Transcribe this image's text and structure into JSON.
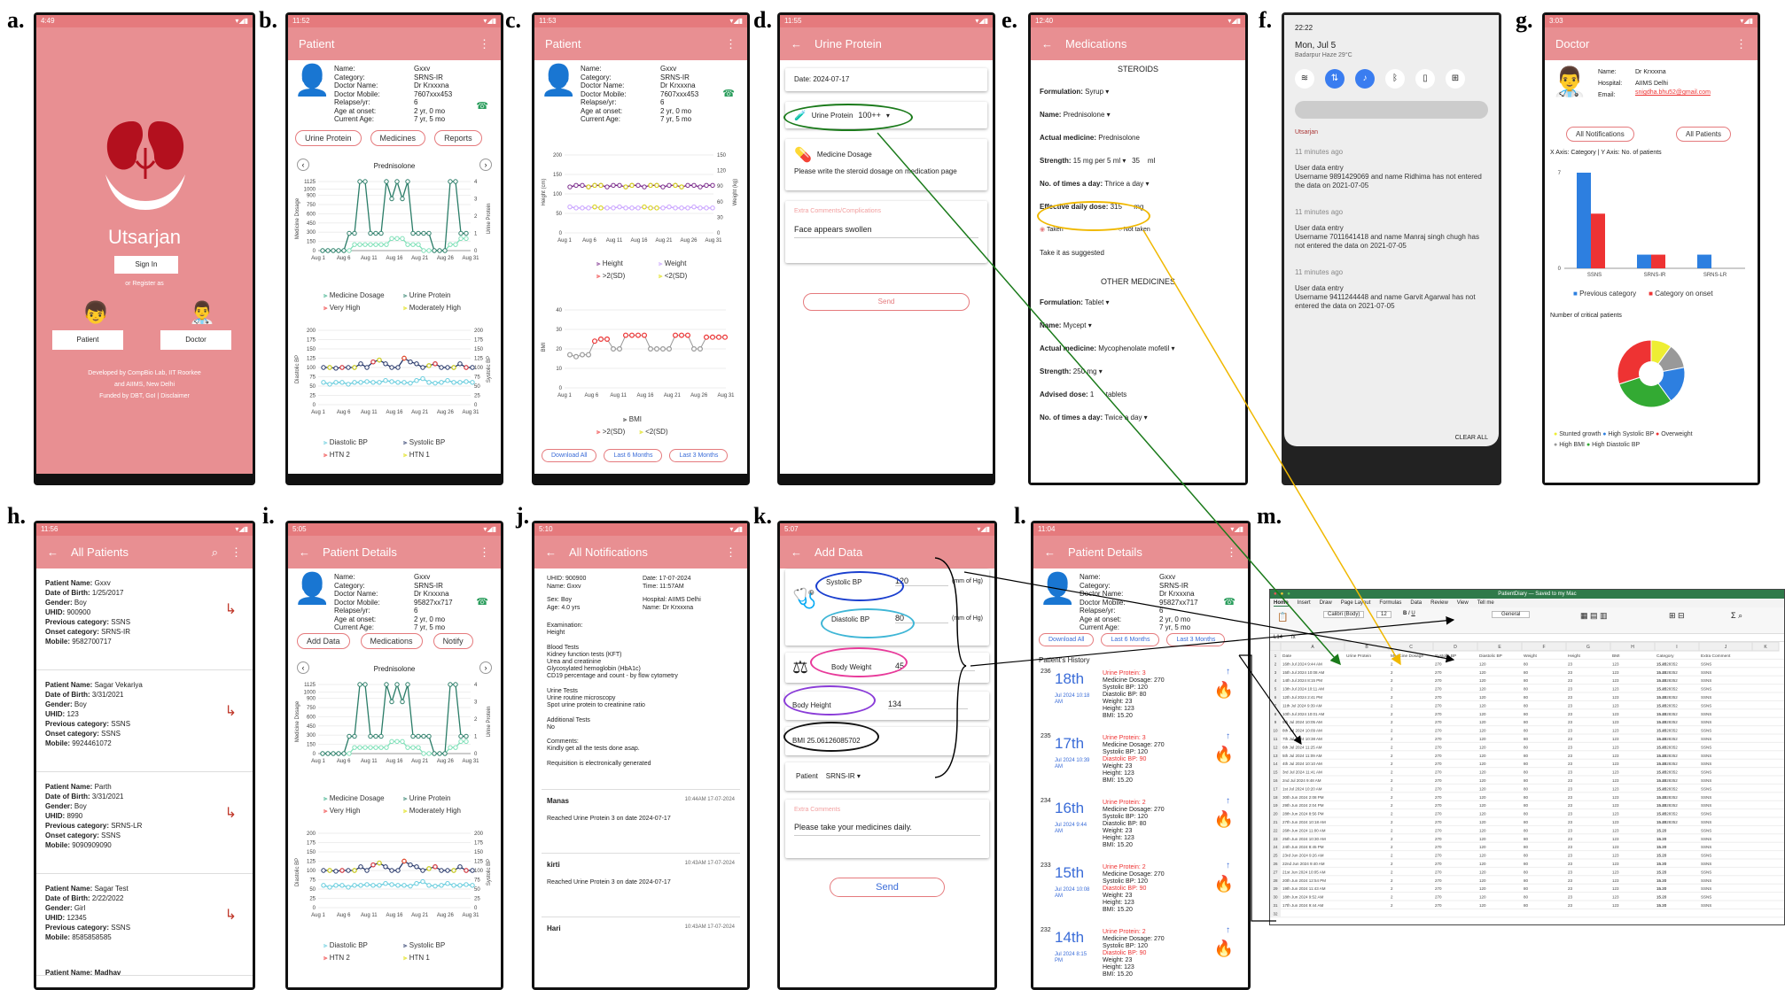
{
  "labels": {
    "a": "a.",
    "b": "b.",
    "c": "c.",
    "d": "d.",
    "e": "e.",
    "f": "f.",
    "g": "g.",
    "h": "h.",
    "i": "i.",
    "j": "j.",
    "k": "k.",
    "l": "l.",
    "m": "m."
  },
  "status": {
    "a": "4:49",
    "b": "11:52",
    "c": "11:53",
    "d": "11:55",
    "e": "12:40",
    "g": "3:03",
    "h": "11:56",
    "i": "5:05",
    "j": "5:10",
    "k": "5:07",
    "l": "11:04"
  },
  "login": {
    "app": "Utsarjan",
    "signin": "Sign In",
    "register": "or Register as",
    "patient": "Patient",
    "doctor": "Doctor",
    "footer1": "Developed by CompBio Lab, IIT Roorkee",
    "footer2": "and AIIMS, New Delhi",
    "footer3": "Funded by DBT, GoI | Disclaimer"
  },
  "patient": {
    "title": "Patient",
    "keys": [
      "Name:",
      "Category:",
      "Doctor Name:",
      "Doctor Mobile:",
      "Relapse/yr:",
      "Age at onset:",
      "Current Age:"
    ],
    "vals": [
      "Gxxv",
      "SRNS-IR",
      "Dr Krxxxna",
      "7607xxx453",
      "6",
      "2 yr, 0 mo",
      "7 yr, 5 mo"
    ],
    "tabs": [
      "Urine Protein",
      "Medicines",
      "Reports"
    ],
    "drug": "Prednisolone",
    "leg1": "Medicine Dosage",
    "leg2": "Urine Protein",
    "leg3": "Very High",
    "leg4": "Moderately High",
    "ylab1": "Medicine Dosage",
    "ylab2": "Urine Protein",
    "ylab3": "Diastolic BP",
    "ylab4": "Systolic BP",
    "leg5": "Diastolic BP",
    "leg6": "Systolic BP",
    "leg7": "HTN 2",
    "leg8": "HTN 1",
    "xt": [
      "Aug 1",
      "Aug 6",
      "Aug 11",
      "Aug 16",
      "Aug 21",
      "Aug 26",
      "Aug 31"
    ]
  },
  "growth": {
    "leg1": "Height",
    "leg2": "Weight",
    "leg3": ">2(SD)",
    "leg4": "<2(SD)",
    "ylab1": "Height (cm)",
    "ylab2": "Weight (kg)",
    "bmi": "BMI",
    "leg5": ">2(SD)",
    "leg6": "<2(SD)",
    "b1": "Download All",
    "b2": "Last 6 Months",
    "b3": "Last 3 Months"
  },
  "urine": {
    "title": "Urine Protein",
    "date": "Date: 2024-07-17",
    "field": "Urine Protein",
    "value": "100++",
    "dosage": "Medicine Dosage",
    "dosage_hint": "Please write the steroid dosage on medication page",
    "extra": "Extra Comments/Complications",
    "comment": "Face appears swollen",
    "send": "Send"
  },
  "meds": {
    "title": "Medications",
    "steroids": "STEROIDS",
    "form_l": "Formulation:",
    "form_v": "Syrup",
    "name_l": "Name:",
    "name_v": "Prednisolone",
    "act_l": "Actual medicine:",
    "act_v": "Prednisolone",
    "str_l": "Strength:",
    "str_v": "15 mg per 5 ml",
    "str_n": "35",
    "str_u": "ml",
    "times_l": "No. of times a day:",
    "times_v": "Thrice a day",
    "eff_l": "Effective daily dose:",
    "eff_v": "315",
    "eff_u": "mg",
    "taken": "Taken",
    "not_taken": "Not taken",
    "sugg": "Take it as suggested",
    "other": "OTHER MEDICINES",
    "form2_v": "Tablet",
    "name2_v": "Mycept",
    "act2_v": "Mycophenolate mofetil",
    "str2_v": "250 mg",
    "adv_l": "Advised dose:",
    "adv_v": "1",
    "adv_u": "tablets",
    "times2_v": "Twice a day"
  },
  "notif": {
    "time": "22:22",
    "date": "Mon, Jul 5",
    "loc": "Badarpur Haze 29°C",
    "app": "Utsarjan",
    "ago": "11 minutes ago",
    "entry": "User data entry",
    "n1": "Username 9891429069 and name Ridhima has not entered the data on 2021-07-05",
    "n2": "Username 7011641418 and name Manraj singh chugh has not entered the data on 2021-07-05",
    "n3": "Username 9411244448 and name Garvit Agarwal has not entered the data on 2021-07-05",
    "clear": "CLEAR ALL"
  },
  "doctor": {
    "title": "Doctor",
    "name_l": "Name:",
    "name_v": "Dr Krxxxna",
    "hosp_l": "Hospital:",
    "hosp_v": "AIIMS Delhi",
    "email_l": "Email:",
    "email_v": "snigdha.bhu52@gmail.com",
    "b1": "All Notifications",
    "b2": "All Patients",
    "axis": "X Axis: Category | Y Axis: No. of patients",
    "cats": [
      "SSNS",
      "SRNS-IR",
      "SRNS-LR"
    ],
    "l1": "Previous category",
    "l2": "Category on onset",
    "crit": "Number of critical patients",
    "pl": [
      "Stunted growth",
      "High Systolic BP",
      "Overweight",
      "High BMI",
      "High Diastolic BP"
    ]
  },
  "chart_data": {
    "type": "bar",
    "categories": [
      "SSNS",
      "SRNS-IR",
      "SRNS-LR"
    ],
    "series": [
      {
        "name": "Previous category",
        "values": [
          7,
          1,
          1
        ]
      },
      {
        "name": "Category on onset",
        "values": [
          4,
          1,
          0
        ]
      }
    ],
    "ylim": [
      0,
      7
    ]
  },
  "allp": {
    "title": "All Patients",
    "pats": [
      {
        "n": "Gxxv",
        "dob": "1/25/2017",
        "g": "Boy",
        "u": "900900",
        "pc": "SSNS",
        "oc": "SRNS-IR",
        "m": "9582700717"
      },
      {
        "n": "Sagar Vekariya",
        "dob": "3/31/2021",
        "g": "Boy",
        "u": "123",
        "pc": "SSNS",
        "oc": "SSNS",
        "m": "9924461072"
      },
      {
        "n": "Parth",
        "dob": "3/31/2021",
        "g": "Boy",
        "u": "8990",
        "pc": "SRNS-LR",
        "oc": "SSNS",
        "m": "9090909090"
      },
      {
        "n": "Sagar Test",
        "dob": "2/22/2022",
        "g": "Girl",
        "u": "12345",
        "pc": "SSNS",
        "oc": "",
        "m": "8585858585"
      }
    ],
    "last": "Patient Name: Madhav",
    "k": [
      "Patient Name:",
      "Date of Birth:",
      "Gender:",
      "UHID:",
      "Previous category:",
      "Onset category:",
      "Mobile:"
    ]
  },
  "pdet": {
    "title": "Patient Details",
    "mob": "95827xx717",
    "b1": "Add Data",
    "b2": "Medications",
    "b3": "Notify"
  },
  "alln": {
    "title": "All Notifications",
    "uhid": "UHID: 900900",
    "name": "Name: Gxxv",
    "sex": "Sex: Boy",
    "age": "Age: 4.0 yrs",
    "date": "Date: 17-07-2024",
    "timev": "Time: 11:57AM",
    "hosp": "Hospital: AIIMS Delhi",
    "doc": "Name: Dr Krxxxna",
    "body": [
      "Examination:",
      "Height",
      "",
      "Blood Tests",
      "Kidney function tests (KFT)",
      "Urea and creatinine",
      "Glycosylated hemoglobin (HbA1c)",
      "CD19 percentage and count - by flow cytometry",
      "",
      "Urine Tests",
      "Urine routine microscopy",
      "Spot urine protein to creatinine ratio",
      "",
      "Additional Tests",
      "No",
      "",
      "Comments:",
      "Kindly get all the tests done asap.",
      "",
      "Requisition is electronically generated"
    ],
    "n": [
      {
        "u": "Manas",
        "t": "10:44AM 17-07-2024",
        "m": "Reached Urine Protein 3 on date 2024-07-17"
      },
      {
        "u": "kirti",
        "t": "10:43AM 17-07-2024",
        "m": "Reached Urine Protein 3 on date 2024-07-17"
      },
      {
        "u": "Hari",
        "t": "10:43AM 17-07-2024",
        "m": ""
      }
    ]
  },
  "add": {
    "title": "Add Data",
    "sys": "Systolic BP",
    "sys_v": "120",
    "dia": "Diastolic BP",
    "dia_v": "80",
    "unit": "(mm of Hg)",
    "bw": "Body Weight",
    "bw_v": "45",
    "bh": "Body Height",
    "bh_v": "134",
    "bmi": "BMI",
    "bmi_v": "25.06126085",
    "bmi_t": "702",
    "pat": "Patient",
    "pat_v": "SRNS-IR",
    "extra": "Extra Comments",
    "comment": "Please take your medicines daily.",
    "send": "Send"
  },
  "hist": {
    "title": "Patient Details",
    "b1": "Download All",
    "b2": "Last 6 Months",
    "b3": "Last 3 Months",
    "h": "Patient's History",
    "items": [
      {
        "no": "236",
        "d": "18th",
        "s": "Jul 2024 10:18 AM",
        "up": "Urine Protein: 3",
        "md": "Medicine Dosage: 270",
        "sb": "Systolic BP: 120",
        "db": "Diastolic BP: 80",
        "w": "Weight: 23",
        "ht": "Height: 123",
        "bmi": "BMI: 15.20"
      },
      {
        "no": "235",
        "d": "17th",
        "s": "Jul 2024 10:39 AM",
        "up": "Urine Protein: 3",
        "md": "Medicine Dosage: 270",
        "sb": "Systolic BP: 120",
        "db": "Diastolic BP: 90",
        "w": "Weight: 23",
        "ht": "Height: 123",
        "bmi": "BMI: 15.20"
      },
      {
        "no": "234",
        "d": "16th",
        "s": "Jul 2024 9:44 AM",
        "up": "Urine Protein: 2",
        "md": "Medicine Dosage: 270",
        "sb": "Systolic BP: 120",
        "db": "Diastolic BP: 80",
        "w": "Weight: 23",
        "ht": "Height: 123",
        "bmi": "BMI: 15.20"
      },
      {
        "no": "233",
        "d": "15th",
        "s": "Jul 2024 10:08 AM",
        "up": "Urine Protein: 2",
        "md": "Medicine Dosage: 270",
        "sb": "Systolic BP: 120",
        "db": "Diastolic BP: 90",
        "w": "Weight: 23",
        "ht": "Height: 123",
        "bmi": "BMI: 15.20"
      },
      {
        "no": "232",
        "d": "14th",
        "s": "Jul 2024 8:15 PM",
        "up": "Urine Protein: 2",
        "md": "Medicine Dosage: 270",
        "sb": "Systolic BP: 120",
        "db": "Diastolic BP: 90",
        "w": "Weight: 23",
        "ht": "Height: 123",
        "bmi": "BMI: 15.20"
      }
    ]
  },
  "excel": {
    "file": "PatientDiary — Saved to my Mac",
    "tabs": [
      "Home",
      "Insert",
      "Draw",
      "Page Layout",
      "Formulas",
      "Data",
      "Review",
      "View",
      "Tell me"
    ],
    "font": "Calibri (Body)",
    "size": "12",
    "fmt": "General",
    "cell": "L14",
    "cols": [
      "Date",
      "Urine Protein",
      "Medicine Dosage",
      "Systolic BP",
      "Diastolic BP",
      "Weight",
      "Height",
      "BMI",
      "Category",
      "Extra Comment"
    ],
    "dates": [
      "16th Jul 2024 9:44 AM",
      "15th Jul 2024 10:08 AM",
      "14th Jul 2024 8:15 PM",
      "13th Jul 2024 10:11 AM",
      "12th Jul 2024 2:41 PM",
      "11th Jul 2024 9:39 AM",
      "10th Jul 2024 10:01 AM",
      "9th Jul 2024 10:05 AM",
      "8th Jul 2024 10:09 AM",
      "7th Jul 2024 10:38 AM",
      "6th Jul 2024 11:25 AM",
      "5th Jul 2024 11:09 AM",
      "4th Jul 2024 10:10 AM",
      "3rd Jul 2024 11:41 AM",
      "2nd Jul 2024 9:48 AM",
      "1st Jul 2024 10:20 AM",
      "30th Jun 2024 2:08 PM",
      "29th Jun 2024 2:04 PM",
      "28th Jun 2024 8:56 PM",
      "27th Jun 2024 10:18 AM",
      "26th Jun 2024 11:00 AM",
      "25th Jun 2024 10:30 AM",
      "24th Jun 2024 8:45 PM",
      "23rd Jun 2024 9:26 AM",
      "22nd Jun 2024 9:40 AM",
      "21st Jun 2024 10:05 AM",
      "20th Jun 2024 12:54 PM",
      "19th Jun 2024 11:43 AM",
      "18th Jun 2024 9:52 AM",
      "17th Jun 2024 9:44 AM"
    ],
    "up": [
      "2",
      "2",
      "2",
      "2",
      "2",
      "2",
      "2",
      "2",
      "2",
      "2",
      "2",
      "2",
      "2",
      "2",
      "2",
      "2",
      "2",
      "2",
      "2",
      "2",
      "2",
      "2",
      "2",
      "2",
      "2",
      "2",
      "2",
      "2",
      "2",
      "2"
    ],
    "md": "270",
    "sb": "120",
    "db": "80",
    "w": "23",
    "h": "123",
    "bmi": "15.20",
    "bmi2": "15.4528352",
    "cat": "SSNS"
  }
}
